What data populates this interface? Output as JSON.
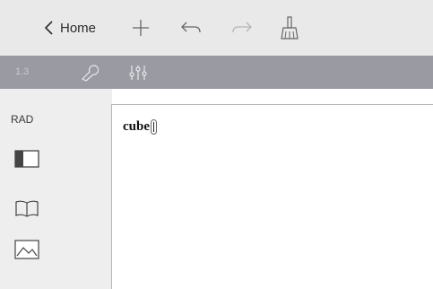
{
  "topbar": {
    "home_label": "Home",
    "buttons": [
      "chevron-left-icon",
      "plus-icon",
      "undo-icon",
      "redo-icon",
      "broom-icon"
    ]
  },
  "toolbar": {
    "page_number": "1.3",
    "tools": [
      "wrench-icon",
      "sliders-icon"
    ]
  },
  "rail": {
    "angle_mode": "RAD",
    "icons": [
      "panel-layout-icon",
      "book-icon",
      "image-icon"
    ]
  },
  "document": {
    "entry_text": "cube"
  },
  "colors": {
    "topbar_bg": "#e9e9ea",
    "toolbar_bg": "#9a9aa3",
    "rail_bg": "#eeeeef",
    "disabled_icon": "#c9c9cf"
  }
}
